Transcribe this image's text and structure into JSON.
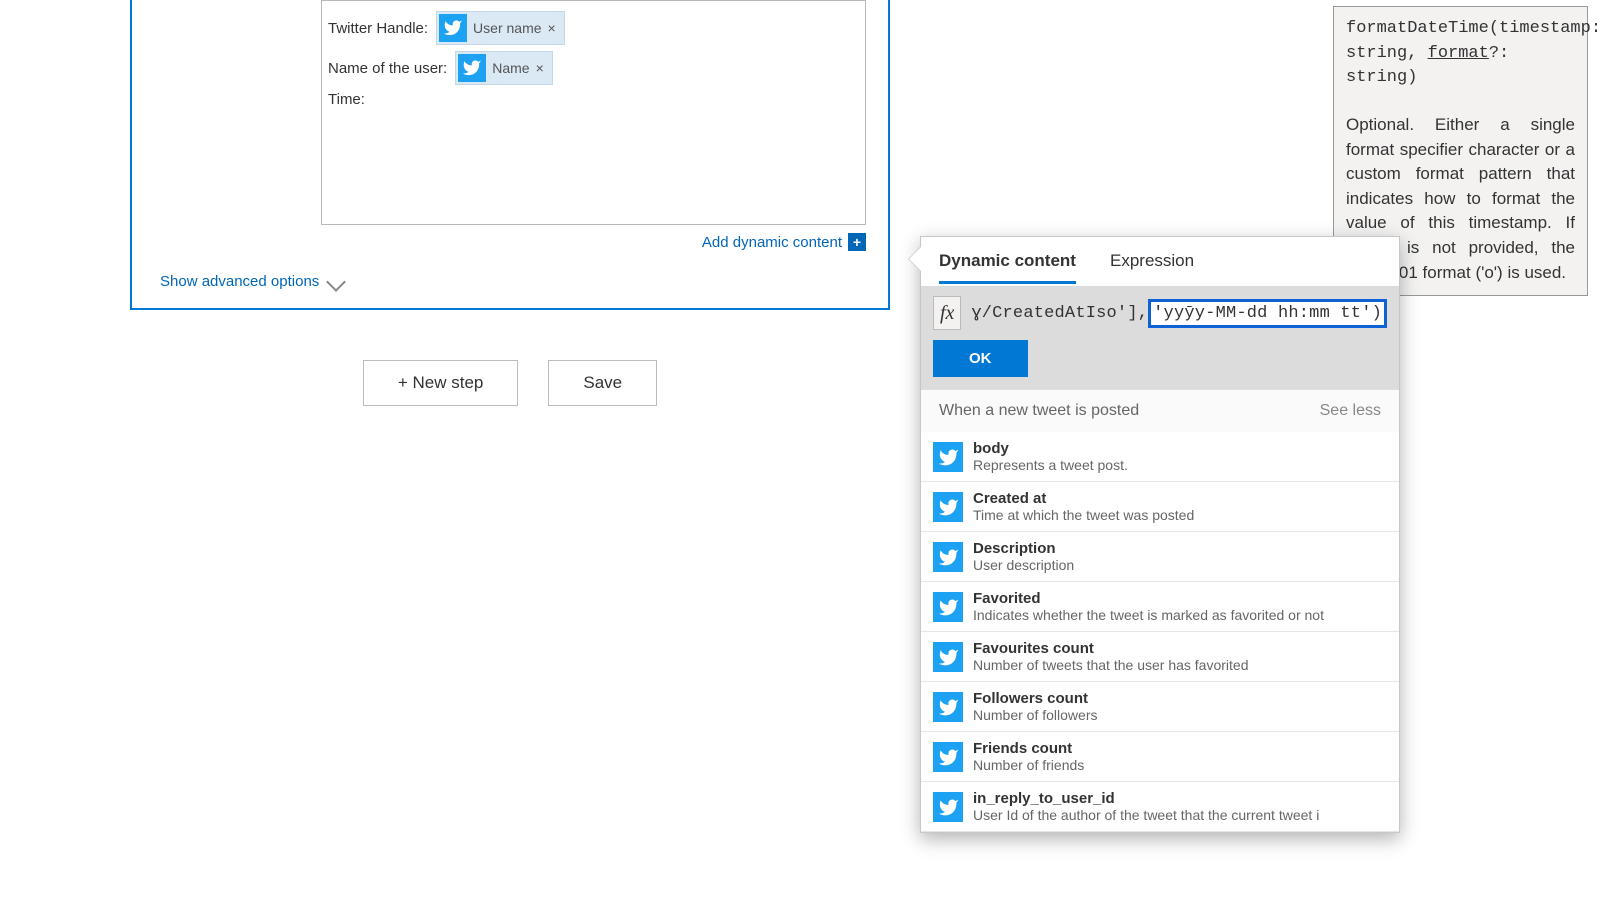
{
  "card": {
    "fields": {
      "twitter_handle": {
        "label": "Twitter Handle:",
        "token_text": "User name"
      },
      "name_of_user": {
        "label": "Name of the user:",
        "token_text": "Name"
      },
      "time": {
        "label": "Time:"
      }
    },
    "add_dynamic": "Add dynamic content",
    "advanced": "Show advanced options"
  },
  "buttons": {
    "new_step": "+ New step",
    "save": "Save"
  },
  "tooltip": {
    "sig_pre": "formatDateTime(timestamp: string, ",
    "sig_arg": "format",
    "sig_post": "?: string)",
    "desc": "Optional. Either a single format specifier character or a custom format pattern that indicates how to format the value of this timestamp. If format is not provided, the ISO 8601 format ('o') is used."
  },
  "panel": {
    "tabs": {
      "dynamic": "Dynamic content",
      "expression": "Expression"
    },
    "fx": "fx",
    "expr_left": "ɣ/CreatedAtIso'], ",
    "expr_hl": "'yyȳy-MM-dd hh:mm tt')",
    "ok": "OK",
    "group_title": "When a new tweet is posted",
    "see_less": "See less",
    "items": [
      {
        "name": "body",
        "desc": "Represents a tweet post."
      },
      {
        "name": "Created at",
        "desc": "Time at which the tweet was posted"
      },
      {
        "name": "Description",
        "desc": "User description"
      },
      {
        "name": "Favorited",
        "desc": "Indicates whether the tweet is marked as favorited or not"
      },
      {
        "name": "Favourites count",
        "desc": "Number of tweets that the user has favorited"
      },
      {
        "name": "Followers count",
        "desc": "Number of followers"
      },
      {
        "name": "Friends count",
        "desc": "Number of friends"
      },
      {
        "name": "in_reply_to_user_id",
        "desc": "User Id of the author of the tweet that the current tweet i"
      }
    ]
  }
}
